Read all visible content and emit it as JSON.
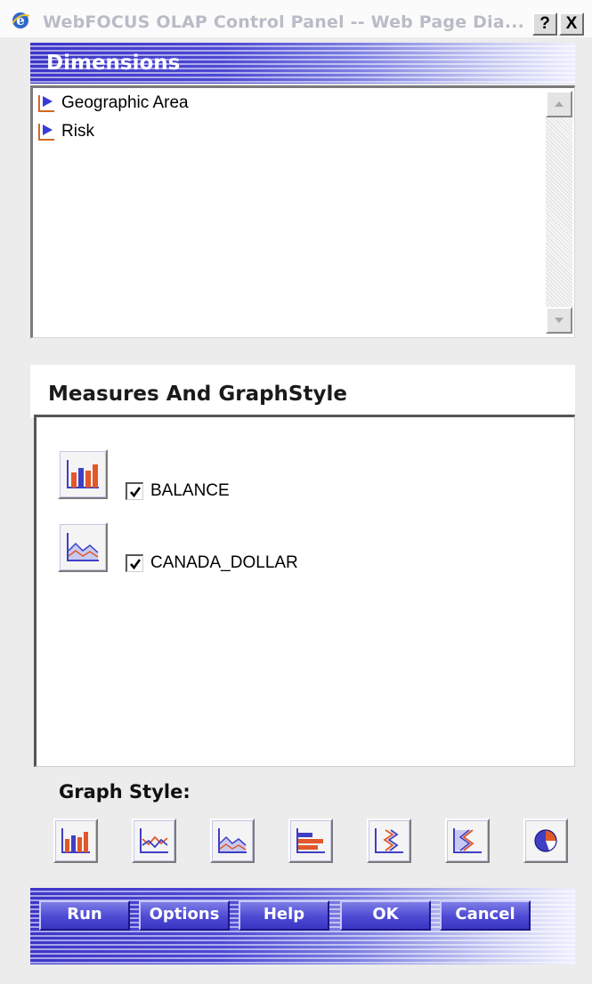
{
  "window": {
    "title": "WebFOCUS OLAP Control Panel -- Web Page Dia...",
    "help_glyph": "?",
    "close_glyph": "X"
  },
  "dimensions": {
    "header": "Dimensions",
    "items": [
      {
        "label": "Geographic Area",
        "icon": "dimension-triangle-icon"
      },
      {
        "label": "Risk",
        "icon": "dimension-triangle-icon"
      }
    ]
  },
  "measures": {
    "header": "Measures And GraphStyle",
    "items": [
      {
        "label": "BALANCE",
        "checked": true,
        "graph_icon": "bar-chart-icon"
      },
      {
        "label": "CANADA_DOLLAR",
        "checked": true,
        "graph_icon": "area-chart-icon"
      }
    ]
  },
  "graph_style": {
    "label": "Graph Style:",
    "options": [
      "vertical-bar-chart-icon",
      "line-chart-icon",
      "area-chart-icon",
      "horizontal-bar-chart-icon",
      "vertical-line-chart-icon",
      "vertical-area-chart-icon",
      "pie-chart-icon"
    ]
  },
  "actions": {
    "run": "Run",
    "options": "Options",
    "help": "Help",
    "ok": "OK",
    "cancel": "Cancel"
  },
  "colors": {
    "accent_blue": "#4d49d4",
    "chart_orange": "#e2582a",
    "chart_blue": "#3f3fc4"
  }
}
